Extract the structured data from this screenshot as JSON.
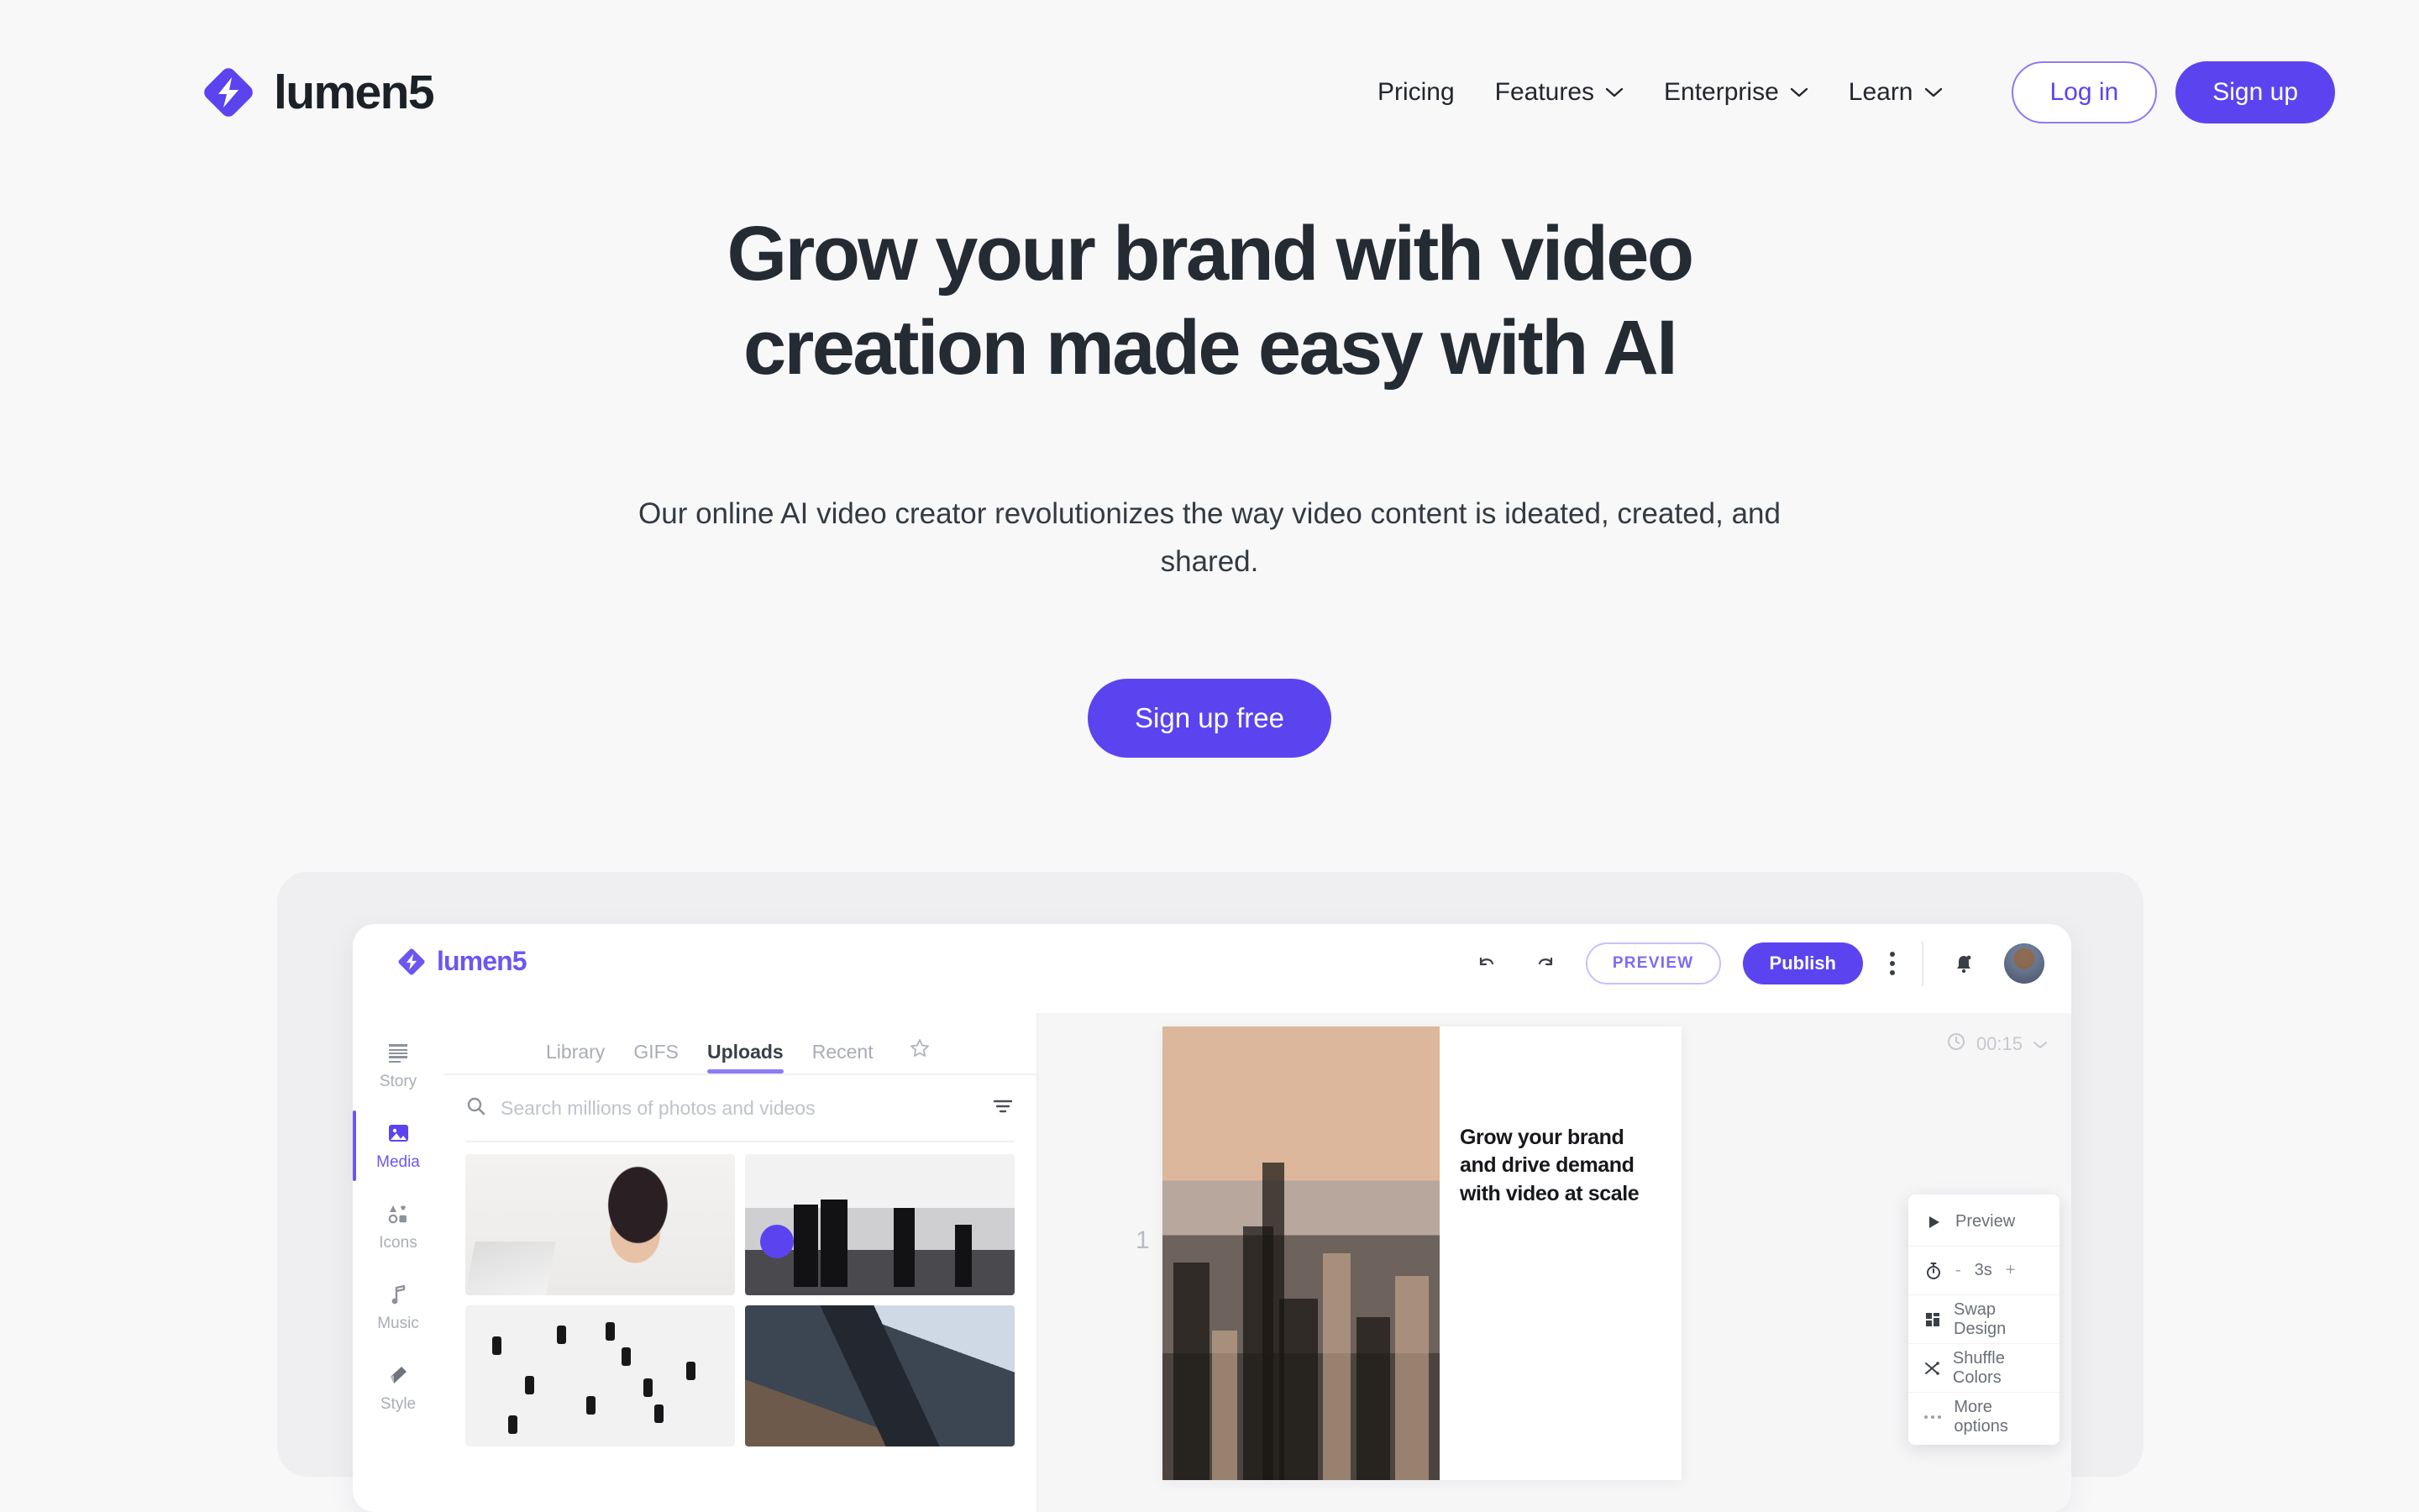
{
  "brand": {
    "name": "lumen5",
    "accent": "#5b44ef",
    "logo_icon": "lumen5-diamond-bolt-logo"
  },
  "nav": {
    "links": [
      {
        "label": "Pricing",
        "has_caret": false
      },
      {
        "label": "Features",
        "has_caret": true
      },
      {
        "label": "Enterprise",
        "has_caret": true
      },
      {
        "label": "Learn",
        "has_caret": true
      }
    ],
    "login_label": "Log in",
    "signup_label": "Sign up"
  },
  "hero": {
    "heading_line1": "Grow your brand with video",
    "heading_line2": "creation made easy with AI",
    "subheading": "Our online AI video creator revolutionizes the way video content is ideated, created, and shared.",
    "cta_label": "Sign up free"
  },
  "mockup": {
    "logo_name": "lumen5",
    "topbar": {
      "undo_icon": "undo-arrow-icon",
      "redo_icon": "redo-arrow-icon",
      "preview_label": "PREVIEW",
      "publish_label": "Publish",
      "more_icon": "kebab-menu-icon",
      "notification_icon": "bell-icon",
      "avatar": "user-avatar"
    },
    "rail": [
      {
        "label": "Story",
        "icon": "story-lines-icon",
        "active": false
      },
      {
        "label": "Media",
        "icon": "media-image-icon",
        "active": true
      },
      {
        "label": "Icons",
        "icon": "icons-grid-icon",
        "active": false
      },
      {
        "label": "Music",
        "icon": "music-note-icon",
        "active": false
      },
      {
        "label": "Style",
        "icon": "style-palette-icon",
        "active": false
      }
    ],
    "tabs": [
      {
        "label": "Library",
        "active": false
      },
      {
        "label": "GIFS",
        "active": false
      },
      {
        "label": "Uploads",
        "active": true
      },
      {
        "label": "Recent",
        "active": false
      }
    ],
    "favorites_icon": "star-icon",
    "search": {
      "placeholder": "Search millions of photos and videos",
      "icon": "search-icon",
      "filter_icon": "filter-icon"
    },
    "canvas": {
      "timer_icon": "clock-icon",
      "timer_value": "00:15",
      "timer_caret": "chevron-down-icon",
      "slide_number": "1",
      "slide_text": "Grow your brand and drive demand with video at scale"
    },
    "context_menu": [
      {
        "label": "Preview",
        "icon": "play-icon"
      },
      {
        "label": "3s",
        "icon": "stopwatch-icon",
        "type": "stepper",
        "minus": "-",
        "plus": "+"
      },
      {
        "label": "Swap Design",
        "icon": "layout-grid-icon"
      },
      {
        "label": "Shuffle Colors",
        "icon": "shuffle-icon"
      },
      {
        "label": "More options",
        "icon": "ellipsis-icon"
      }
    ]
  }
}
